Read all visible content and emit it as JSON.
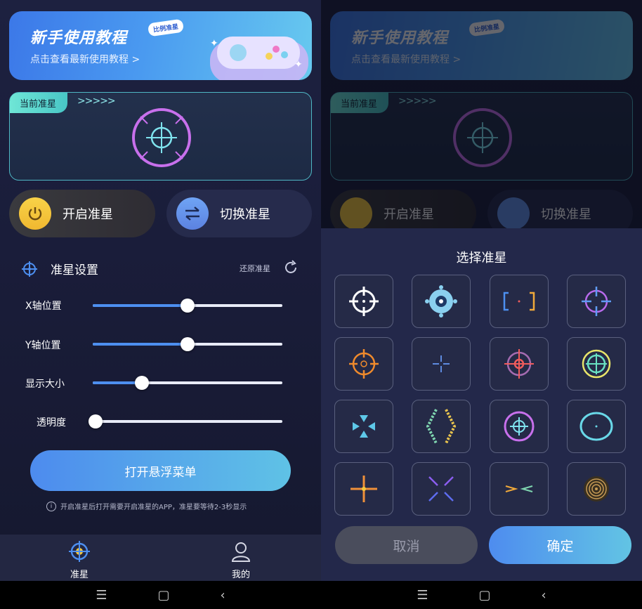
{
  "left": {
    "banner": {
      "title": "新手使用教程",
      "tag": "比例准星",
      "subtitle": "点击查看最新使用教程 >"
    },
    "current": {
      "tag": "当前准星",
      "arrows": ">>>>>"
    },
    "buttons": {
      "open": "开启准星",
      "switch": "切换准星"
    },
    "settings": {
      "title": "准星设置",
      "restore": "还原准星",
      "sliders": [
        {
          "label": "X轴位置",
          "value": 0.5
        },
        {
          "label": "Y轴位置",
          "value": 0.5
        },
        {
          "label": "显示大小",
          "value": 0.26
        },
        {
          "label": "透明度",
          "value": 0.0
        }
      ]
    },
    "float_button": "打开悬浮菜单",
    "hint": "开启准星后打开需要开启准星的APP，准星要等待2-3秒显示",
    "tabs": [
      {
        "label": "准星"
      },
      {
        "label": "我的"
      }
    ]
  },
  "right": {
    "sheet_title": "选择准星",
    "cancel": "取消",
    "confirm": "确定",
    "crosshairs": [
      "crosshair-white",
      "crosshair-orb",
      "crosshair-brackets",
      "crosshair-purple-blue",
      "crosshair-orange",
      "crosshair-small-cross",
      "crosshair-red-purple",
      "crosshair-green-yellow",
      "crosshair-triangles",
      "crosshair-chevrons",
      "crosshair-purple-ring",
      "crosshair-cyan-ring",
      "crosshair-orange-star",
      "crosshair-x-lines",
      "crosshair-arrows",
      "crosshair-target-rings"
    ]
  },
  "colors": {
    "accent_blue": "#4d8ff0",
    "accent_cyan": "#5fc2e6",
    "power_yellow": "#f5c83a",
    "purple": "#c66fe8"
  }
}
